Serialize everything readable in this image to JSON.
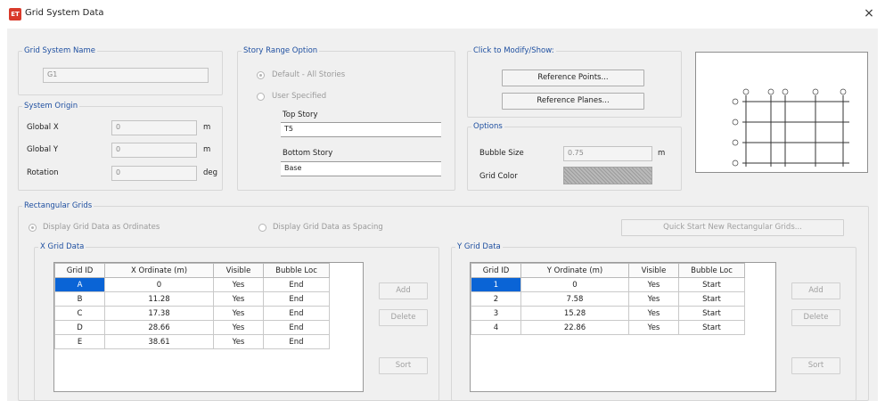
{
  "window": {
    "title": "Grid System Data",
    "app_icon_text": "ET",
    "close_glyph": "×"
  },
  "grid_system_name": {
    "label": "Grid System Name",
    "value": "G1"
  },
  "system_origin": {
    "label": "System Origin",
    "rows": [
      {
        "label": "Global X",
        "value": "0",
        "unit": "m"
      },
      {
        "label": "Global Y",
        "value": "0",
        "unit": "m"
      },
      {
        "label": "Rotation",
        "value": "0",
        "unit": "deg"
      }
    ]
  },
  "story_range": {
    "label": "Story Range Option",
    "default_option": "Default - All Stories",
    "user_option": "User Specified",
    "top_story_label": "Top Story",
    "top_story_value": "T5",
    "bottom_story_label": "Bottom Story",
    "bottom_story_value": "Base"
  },
  "click_to_modify": {
    "label": "Click to Modify/Show:",
    "reference_points": "Reference Points...",
    "reference_planes": "Reference Planes..."
  },
  "options": {
    "label": "Options",
    "bubble_size_label": "Bubble Size",
    "bubble_size_value": "0.75",
    "bubble_size_unit": "m",
    "grid_color_label": "Grid Color"
  },
  "rectangular_grids": {
    "label": "Rectangular Grids",
    "ordinates_option": "Display Grid Data as Ordinates",
    "spacing_option": "Display Grid Data as Spacing",
    "quick_start_button": "Quick Start New Rectangular Grids..."
  },
  "x_grid": {
    "label": "X Grid Data",
    "headers": [
      "Grid ID",
      "X Ordinate (m)",
      "Visible",
      "Bubble Loc"
    ],
    "rows": [
      [
        "A",
        "0",
        "Yes",
        "End"
      ],
      [
        "B",
        "11.28",
        "Yes",
        "End"
      ],
      [
        "C",
        "17.38",
        "Yes",
        "End"
      ],
      [
        "D",
        "28.66",
        "Yes",
        "End"
      ],
      [
        "E",
        "38.61",
        "Yes",
        "End"
      ]
    ],
    "buttons": {
      "add": "Add",
      "delete": "Delete",
      "sort": "Sort"
    }
  },
  "y_grid": {
    "label": "Y Grid Data",
    "headers": [
      "Grid ID",
      "Y Ordinate (m)",
      "Visible",
      "Bubble Loc"
    ],
    "rows": [
      [
        "1",
        "0",
        "Yes",
        "Start"
      ],
      [
        "2",
        "7.58",
        "Yes",
        "Start"
      ],
      [
        "3",
        "15.28",
        "Yes",
        "Start"
      ],
      [
        "4",
        "22.86",
        "Yes",
        "Start"
      ]
    ],
    "buttons": {
      "add": "Add",
      "delete": "Delete",
      "sort": "Sort"
    }
  },
  "colors": {
    "accent": "#0a64d6",
    "legend_text": "#1e4fa0",
    "app_icon": "#d93a2b"
  }
}
